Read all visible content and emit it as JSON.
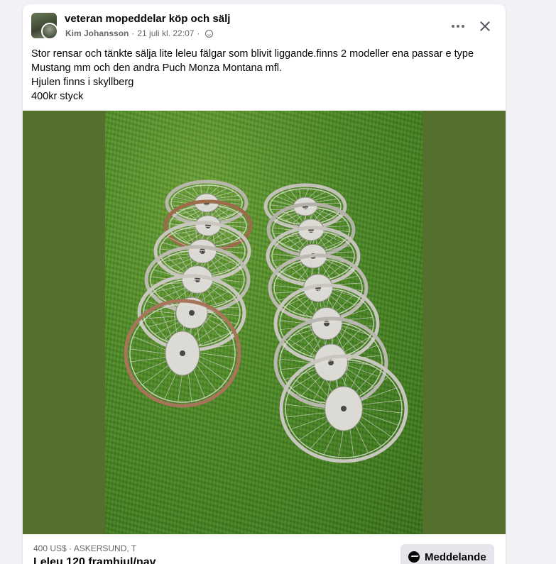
{
  "post": {
    "group_name": "veteran mopeddelar köp och sälj",
    "author": "Kim Johansson",
    "separator": "·",
    "date": "21 juli kl. 22:07",
    "separator2": "·",
    "privacy_icon": "globe-icon",
    "text_lines": [
      "Stor rensar och tänkte sälja lite leleu fälgar som blivit liggande.finns 2 modeller ena passar e type",
      "Mustang mm och den andra Puch Monza Montana mfl.",
      "Hjulen finns i skyllberg",
      "400kr styck"
    ]
  },
  "actions": {
    "more_icon": "more-options-icon",
    "close_icon": "close-icon"
  },
  "listing": {
    "price_location": "400 US$ · ASKERSUND, T",
    "title": "Leleu 120 framhjul/nav",
    "message_button": "Meddelande",
    "message_icon": "messenger-icon"
  },
  "colors": {
    "photo_backdrop": "#556f2f",
    "card_background": "#ffffff",
    "page_background": "#f0f2f5"
  }
}
